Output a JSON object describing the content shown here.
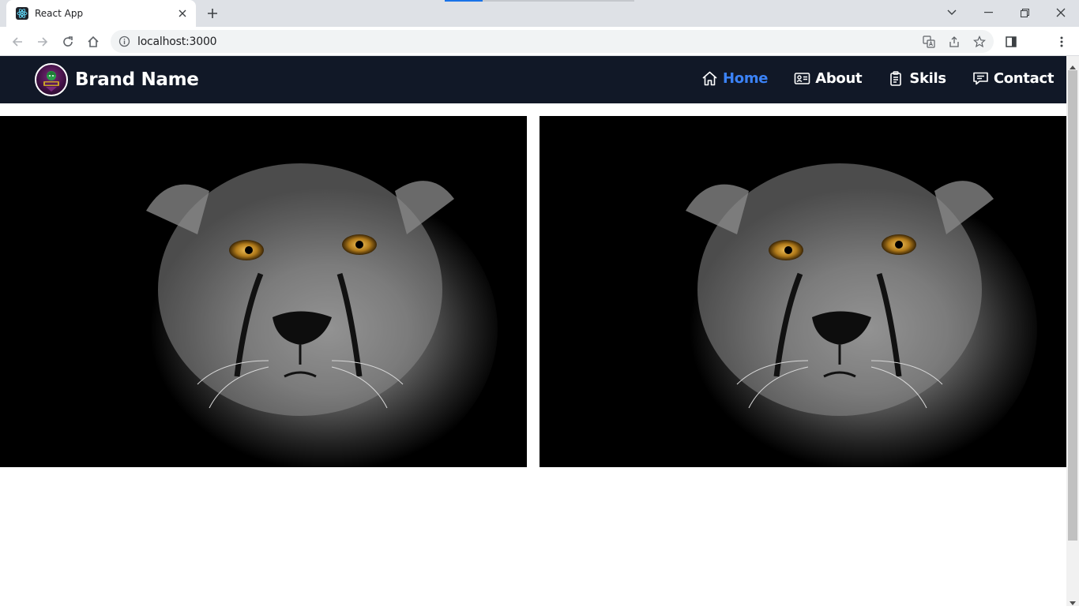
{
  "browser": {
    "tab_title": "React App",
    "url": "localhost:3000"
  },
  "site": {
    "brand_name": "Brand Name",
    "nav": [
      {
        "label": "Home",
        "icon": "home-icon",
        "active": true
      },
      {
        "label": "About",
        "icon": "id-card-icon",
        "active": false
      },
      {
        "label": "Skils",
        "icon": "clipboard-icon",
        "active": false
      },
      {
        "label": "Contact",
        "icon": "chat-icon",
        "active": false
      }
    ],
    "images": [
      {
        "subject": "cheetah-portrait"
      },
      {
        "subject": "cheetah-portrait"
      }
    ]
  },
  "colors": {
    "navbar_bg": "#111827",
    "nav_active": "#3b82f6",
    "nav_text": "#ffffff",
    "chrome_bg": "#dee1e6"
  }
}
